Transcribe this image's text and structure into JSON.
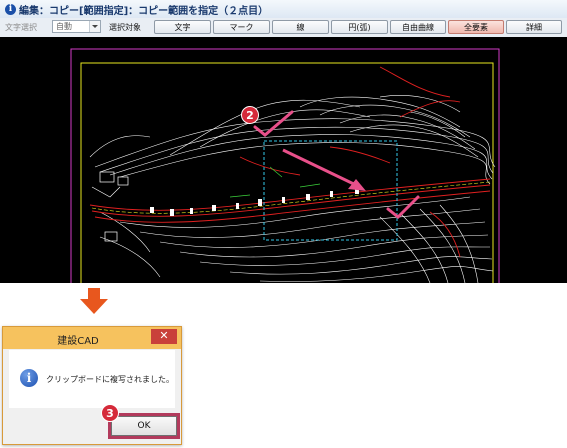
{
  "instruction_bar": {
    "icon": "info-icon",
    "text": "編集：コピー[範囲指定]：コピー範囲を指定（２点目）"
  },
  "toolbar": {
    "font_select_label": "文字選択",
    "font_select_value": "自動",
    "target_label": "選択対象",
    "buttons": [
      {
        "label": "文字",
        "active": false
      },
      {
        "label": "マーク",
        "active": false
      },
      {
        "label": "線",
        "active": false
      },
      {
        "label": "円(弧)",
        "active": false
      },
      {
        "label": "自由曲線",
        "active": false
      },
      {
        "label": "全要素",
        "active": true
      },
      {
        "label": "詳細",
        "active": false
      }
    ]
  },
  "canvas": {
    "step_marker": "2",
    "colors": {
      "background": "#000000",
      "outer_frame": "#d43cc8",
      "inner_frame": "#e8e820",
      "contours": "#ffffff",
      "red_lines": "#e02020",
      "selection_box": "#34c8e8",
      "arrow_pink": "#e8508a"
    }
  },
  "arrow_down_color": "#e8571e",
  "dialog": {
    "title": "建設CAD",
    "close_glyph": "✕",
    "icon": "info-icon",
    "message": "クリップボードに複写されました。",
    "ok_label": "OK",
    "step_marker": "3"
  }
}
